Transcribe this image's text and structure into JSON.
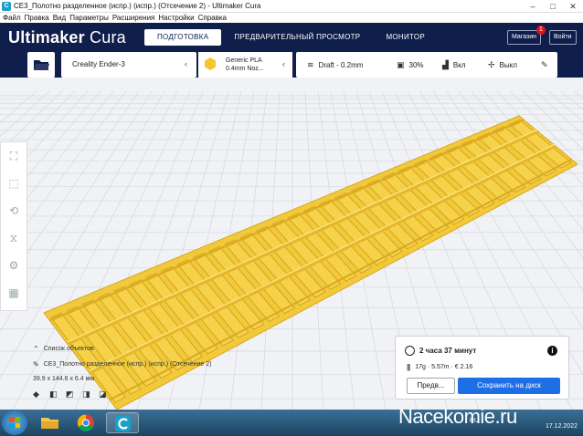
{
  "window": {
    "title": "CE3_Полотно разделенное (испр.) (испр.) (Отсечение 2) - Ultimaker Cura",
    "minimize": "–",
    "maximize": "□",
    "close": "✕"
  },
  "menu": [
    "Файл",
    "Правка",
    "Вид",
    "Параметры",
    "Расширения",
    "Настройки",
    "Справка"
  ],
  "header": {
    "brand_bold": "Ultimaker",
    "brand_light": "Cura",
    "tabs": [
      "ПОДГОТОВКА",
      "ПРЕДВАРИТЕЛЬНЫЙ ПРОСМОТР",
      "МОНИТОР"
    ],
    "active_tab": 0,
    "marketplace_label": "Магазин",
    "marketplace_badge": "1",
    "login_label": "Войти"
  },
  "settings_bar": {
    "printer": "Creality Ender-3",
    "material_line1": "Generic PLA",
    "material_line2": "0.4mm Noz...",
    "profile": "Draft - 0.2mm",
    "infill": "30%",
    "support": "Вкл",
    "adhesion": "Выкл",
    "material_color": "#f7c52e"
  },
  "object": {
    "list_label": "Список объектов",
    "name": "CE3_Полотно разделенное (испр.) (испр.) (Отсечение 2)",
    "dimensions": "39.9 x 144.6 x 6.4 мм"
  },
  "print_panel": {
    "time": "2 часа 37 минут",
    "material": "17g · 5.57m · € 2.16",
    "preview_label": "Предв...",
    "save_label": "Сохранить на диск"
  },
  "taskbar": {
    "lang": "RU",
    "time": "",
    "date": "17.12.2022"
  },
  "watermark": "Nacekomie.ru",
  "colors": {
    "header": "#0f1e4a",
    "accent": "#1e6ee6",
    "model": "#f5d24a"
  }
}
